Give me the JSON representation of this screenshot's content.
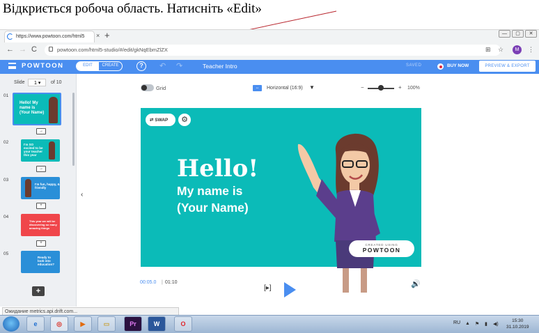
{
  "caption": "Відкриється робоча область. Натисніть «Edit»",
  "browser": {
    "tab_title": "https://www.powtoon.com/html5",
    "tab_close": "×",
    "new_tab": "+",
    "back": "←",
    "forward": "→",
    "reload": "C",
    "url": "powtoon.com/html5-studio/#/edit/gkNqEbmZlZX",
    "window_minimize": "—",
    "window_restore": "▢",
    "window_close": "✕",
    "translate_icon": "⊞",
    "star_icon": "☆",
    "profile_initial": "M",
    "menu_icon": "⋮"
  },
  "toolbar": {
    "logo": "POWTOON",
    "mode_edit": "EDIT",
    "mode_create": "CREATE",
    "help": "?",
    "undo": "↶",
    "redo": "↷",
    "title": "Teacher Intro",
    "saved": "SAVED",
    "buy_now": "BUY NOW",
    "preview_export": "PREVIEW & EXPORT"
  },
  "slides_panel": {
    "slide_label": "Slide",
    "current": "1",
    "of_label": "of 10",
    "items": [
      {
        "number": "01",
        "text": "Hello! My name is (Your Name)",
        "bg": "#0bbbb8"
      },
      {
        "number": "02",
        "text": "I'm SO excited to be your teacher this year",
        "bg": "#0bbbb8"
      },
      {
        "number": "03",
        "text": "I'm fun, happy, & friendly",
        "bg": "#2a8fd8"
      },
      {
        "number": "04",
        "text": "This year we will be discovering so many amazing things",
        "bg": "#f0464b"
      },
      {
        "number": "05",
        "text": "Ready to look into education?",
        "bg": "#2a8fd8"
      }
    ],
    "add_slide": "+",
    "collapse": "‹"
  },
  "canvas_controls": {
    "grid_label": "Grid",
    "ratio_icon": "↔",
    "ratio_label": "Horizontal (16:9)",
    "ratio_caret": "▼",
    "zoom_minus": "−",
    "zoom_plus": "+",
    "zoom_value": "100%",
    "zoom_level": 0.5
  },
  "stage": {
    "swap_label": "⇄ SWAP",
    "settings_icon": "⚙",
    "headline": "Hello!",
    "line1": "My name is",
    "line2": "(Your Name)",
    "badge_top": "CREATED USING",
    "badge_logo": "POWTOON",
    "bg_color": "#0bbbb8"
  },
  "playback": {
    "current_time": "00:05.0",
    "separator": "|",
    "total_time": "01:10",
    "step_icon": "[▸]",
    "volume_icon": "🔊"
  },
  "status_bar": "Ожидание metrics.api.drift.com...",
  "taskbar": {
    "apps": [
      "e",
      "◎",
      "▶",
      "▭",
      "Pr",
      "W",
      "O"
    ],
    "language": "RU",
    "tray_icons": [
      "▲",
      "⚑",
      "▮",
      "◀)"
    ],
    "time": "15:30",
    "date": "31.10.2019"
  },
  "colors": {
    "accent": "#4a8ef0",
    "stage": "#0bbbb8",
    "arrow": "#b8252d"
  }
}
